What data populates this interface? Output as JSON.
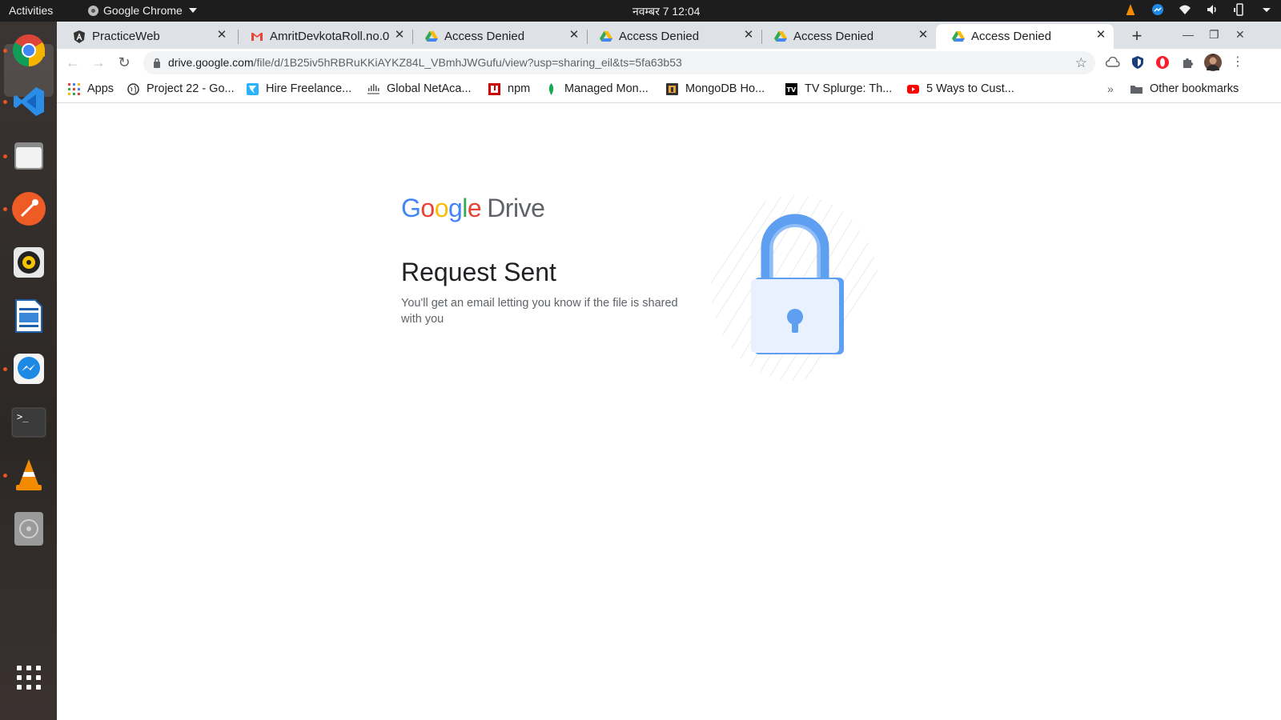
{
  "system": {
    "activities": "Activities",
    "app_name": "Google Chrome",
    "clock": "नवम्बर 7  12:04"
  },
  "tabs": [
    {
      "title": "PracticeWeb",
      "icon": "angular-icon",
      "active": false
    },
    {
      "title": "AmritDevkotaRoll.no.0",
      "icon": "gmail-icon",
      "active": false
    },
    {
      "title": "Access Denied",
      "icon": "drive-icon",
      "active": false
    },
    {
      "title": "Access Denied",
      "icon": "drive-icon",
      "active": false
    },
    {
      "title": "Access Denied",
      "icon": "drive-icon",
      "active": false
    },
    {
      "title": "Access Denied",
      "icon": "drive-icon",
      "active": true
    }
  ],
  "address_bar": {
    "host": "drive.google.com",
    "path": "/file/d/1B25iv5hRBRuKKiAYKZ84L_VBmhJWGufu/view?usp=sharing_eil&ts=5fa63b53"
  },
  "bookmarks": {
    "items": [
      {
        "label": "Apps",
        "icon": "apps-grid-icon"
      },
      {
        "label": "Project 22 - Go...",
        "icon": "globe-icon"
      },
      {
        "label": "Hire Freelance...",
        "icon": "freelancer-icon"
      },
      {
        "label": "Global NetAca...",
        "icon": "netacad-icon"
      },
      {
        "label": "npm",
        "icon": "npm-icon"
      },
      {
        "label": "Managed Mon...",
        "icon": "mongodb-leaf-icon"
      },
      {
        "label": "MongoDB Ho...",
        "icon": "bookmark-site-icon"
      },
      {
        "label": "TV Splurge: Th...",
        "icon": "tv-icon"
      },
      {
        "label": "5 Ways to Cust...",
        "icon": "youtube-icon"
      }
    ],
    "other": "Other bookmarks"
  },
  "content": {
    "logo_google": "Google",
    "logo_drive": "Drive",
    "headline": "Request Sent",
    "subtext": "You'll get an email letting you know if the file is shared with you"
  },
  "colors": {
    "google_blue": "#4285f4",
    "google_red": "#ea4335",
    "google_yellow": "#fbbc05",
    "google_green": "#34a853",
    "ubuntu_orange": "#e95420"
  }
}
